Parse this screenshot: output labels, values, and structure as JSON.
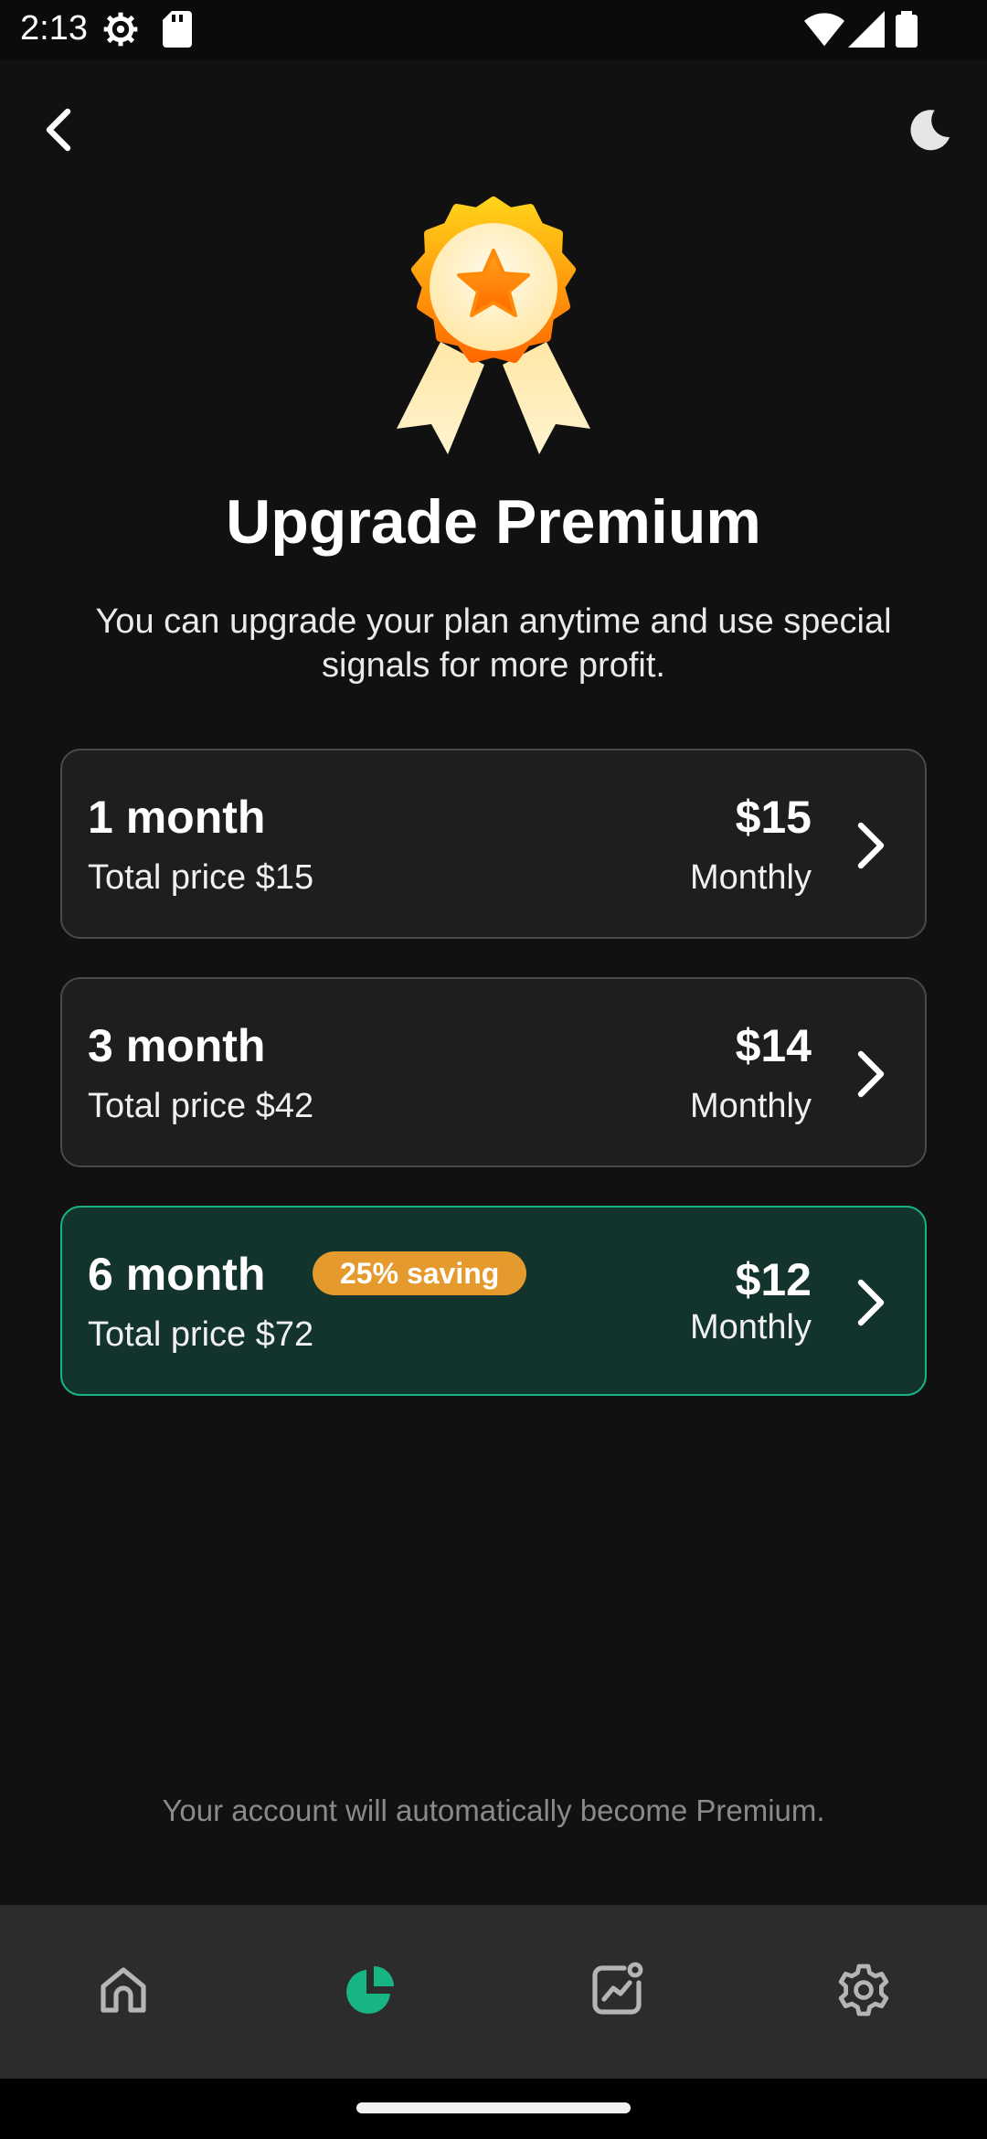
{
  "status_bar": {
    "time": "2:13",
    "icons": [
      "settings-gear-icon",
      "sd-card-icon",
      "wifi-icon",
      "signal-icon",
      "battery-icon"
    ]
  },
  "header": {
    "back_icon": "chevron-left-icon",
    "theme_icon": "moon-icon"
  },
  "hero": {
    "icon": "medal-star-icon",
    "title": "Upgrade Premium",
    "subtitle": "You can upgrade your plan anytime and use special signals for more profit."
  },
  "plans": [
    {
      "name": "1 month",
      "total": "Total price $15",
      "price": "$15",
      "period": "Monthly",
      "badge": "",
      "selected": false
    },
    {
      "name": "3 month",
      "total": "Total price $42",
      "price": "$14",
      "period": "Monthly",
      "badge": "",
      "selected": false
    },
    {
      "name": "6 month",
      "total": "Total price $72",
      "price": "$12",
      "period": "Monthly",
      "badge": "25% saving",
      "selected": true
    }
  ],
  "footer_note": "Your account will automatically become Premium.",
  "bottom_nav": {
    "items": [
      {
        "icon": "home-icon",
        "active": false
      },
      {
        "icon": "pie-chart-icon",
        "active": true
      },
      {
        "icon": "chart-notification-icon",
        "active": false
      },
      {
        "icon": "settings-icon",
        "active": false
      }
    ]
  },
  "colors": {
    "background": "#111111",
    "card": "#1e1e1e",
    "card_border": "#4a4a4a",
    "accent_green": "#17b584",
    "selected_card": "#13332d",
    "badge_orange": "#e49a2c",
    "nav_bar": "#2c2c2c"
  }
}
